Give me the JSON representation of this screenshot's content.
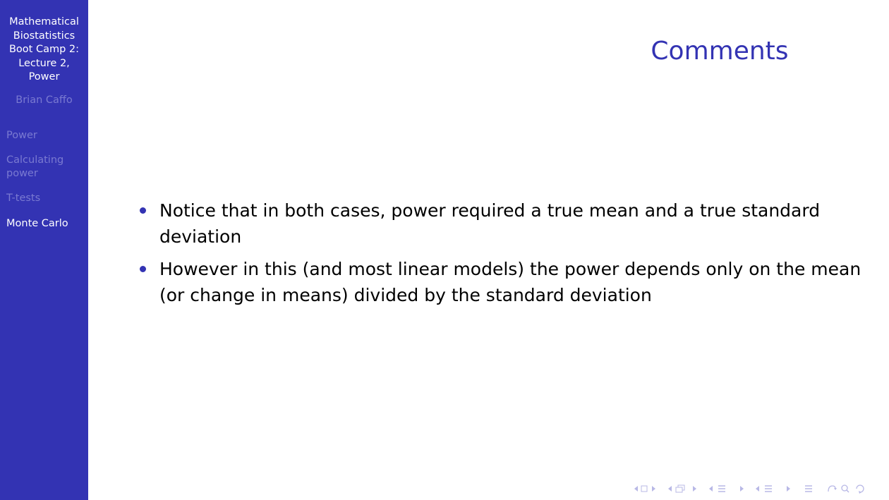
{
  "sidebar": {
    "title_lines": [
      "Mathematical",
      "Biostatistics",
      "Boot Camp 2:",
      "Lecture 2,",
      "Power"
    ],
    "author": "Brian Caffo",
    "nav": [
      {
        "lines": [
          "Power"
        ],
        "active": false
      },
      {
        "lines": [
          "Calculating",
          "power"
        ],
        "active": false
      },
      {
        "lines": [
          "T-tests"
        ],
        "active": false
      },
      {
        "lines": [
          "Monte Carlo"
        ],
        "active": true
      }
    ]
  },
  "frame": {
    "title": "Comments",
    "bullets": [
      {
        "lines": [
          "Notice that in both cases, power required a true mean and a true standard",
          "deviation"
        ]
      },
      {
        "lines": [
          "However in this (and most linear models) the power depends only on the mean",
          "(or change in means) divided by the standard deviation"
        ]
      }
    ]
  },
  "navigation_icons": [
    "first-page-icon",
    "prev-frame-icon",
    "next-frame-icon",
    "subsection-icon",
    "section-icon",
    "document-icon",
    "search-icon"
  ],
  "colors": {
    "sidebar_bg": "#3333b3",
    "title": "#3333b3",
    "sidebar_dim": "#7a7ad1",
    "nav_icons": "#b8b8e6"
  }
}
